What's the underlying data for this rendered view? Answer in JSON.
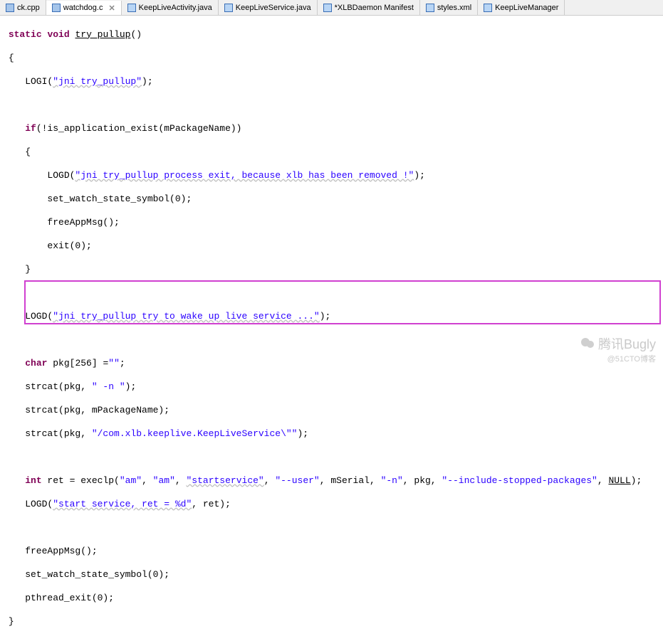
{
  "tabs": {
    "t0": {
      "label": "ck.cpp"
    },
    "t1": {
      "label": "watchdog.c"
    },
    "t2": {
      "label": "KeepLiveActivity.java"
    },
    "t3": {
      "label": "KeepLiveService.java"
    },
    "t4": {
      "label": "*XLBDaemon Manifest"
    },
    "t5": {
      "label": "styles.xml"
    },
    "t6": {
      "label": "KeepLiveManager"
    }
  },
  "close_glyph": "✕",
  "code": {
    "l1_kw1": "static",
    "l1_kw2": "void",
    "l1_fn": "try_pullup",
    "l1_rest": "()",
    "l2": "{",
    "l3_a": "    LOGI(",
    "l3_s": "\"jni try_pullup\"",
    "l3_b": ");",
    "l4": "",
    "l5_a": "    ",
    "l5_kw": "if",
    "l5_b": "(!is_application_exist(mPackageName))",
    "l6": "    {",
    "l7_a": "        LOGD(",
    "l7_s": "\"jni try_pullup process exit, because xlb has been removed !\"",
    "l7_b": ");",
    "l8": "        set_watch_state_symbol(0);",
    "l9": "        freeAppMsg();",
    "l10": "        exit(0);",
    "l11": "    }",
    "l12": "",
    "l13_a": "    LOGD(",
    "l13_s": "\"jni try_pullup try to wake up live service ...\"",
    "l13_b": ");",
    "l14": "",
    "l15_a": "    ",
    "l15_kw": "char",
    "l15_b": " pkg[256] =",
    "l15_s": "\"\"",
    "l15_c": ";",
    "l16_a": "    strcat(pkg, ",
    "l16_s": "\" -n \"",
    "l16_b": ");",
    "l17": "    strcat(pkg, mPackageName);",
    "l18_a": "    strcat(pkg, ",
    "l18_s": "\"/com.xlb.keeplive.KeepLiveService\\\"\"",
    "l18_b": ");",
    "l19": "",
    "l20_a": "    ",
    "l20_kw": "int",
    "l20_b": " ret = execlp(",
    "l20_s1": "\"am\"",
    "l20_c1": ", ",
    "l20_s2": "\"am\"",
    "l20_c2": ", ",
    "l20_s3": "\"startservice\"",
    "l20_c3": ", ",
    "l20_s4": "\"--user\"",
    "l20_c4": ", mSerial, ",
    "l20_s5": "\"-n\"",
    "l20_c5": ", pkg, ",
    "l20_s6": "\"--include-stopped-packages\"",
    "l20_c6": ", ",
    "l20_null": "NULL",
    "l20_c7": ");",
    "l21_a": "    LOGD(",
    "l21_s": "\"start service, ret = %d\"",
    "l21_b": ", ret);",
    "l22": "",
    "l23": "    freeAppMsg();",
    "l24": "    set_watch_state_symbol(0);",
    "l25": "    pthread_exit(0);",
    "l26": "}"
  },
  "watermark": {
    "main": "腾讯Bugly",
    "sub": "@51CTO博客"
  }
}
